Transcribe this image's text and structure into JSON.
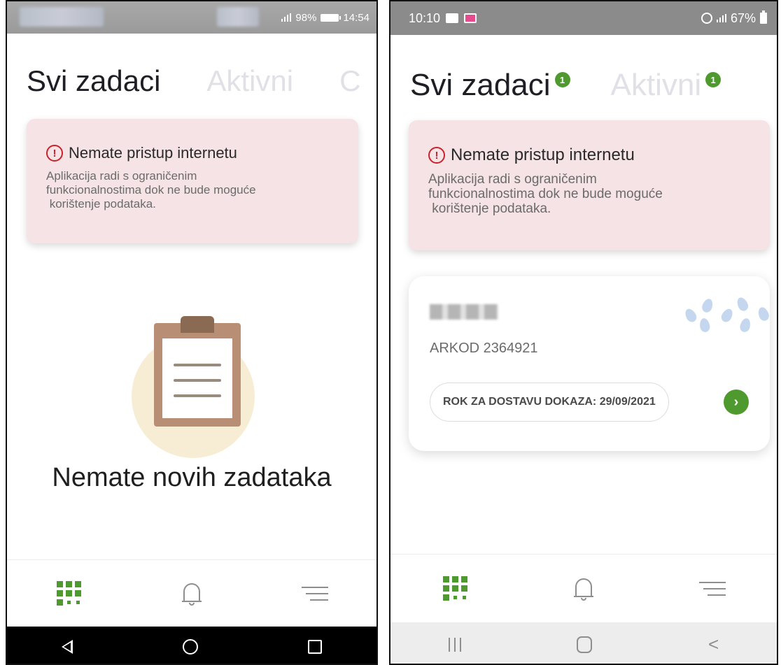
{
  "left_screen": {
    "status_bar": {
      "battery": "98%",
      "time": "14:54"
    },
    "tabs": [
      {
        "label": "Svi zadaci",
        "active": true
      },
      {
        "label": "Aktivni",
        "active": false
      },
      {
        "label": "C",
        "active": false
      }
    ],
    "warning": {
      "title": "Nemate pristup internetu",
      "line1": "Aplikacija radi s ograničenim",
      "line2": "funkcionalnostima dok ne bude moguće",
      "line3": " korištenje podataka."
    },
    "empty_state": {
      "message": "Nemate novih zadataka"
    },
    "bottom_nav": [
      "grid-icon",
      "bell-icon",
      "menu-icon"
    ],
    "system_nav": [
      "back-icon",
      "home-icon",
      "recents-icon"
    ]
  },
  "right_screen": {
    "status_bar": {
      "time": "10:10",
      "battery": "67%"
    },
    "tabs": [
      {
        "label": "Svi zadaci",
        "badge": "1",
        "active": true
      },
      {
        "label": "Aktivni",
        "badge": "1",
        "active": false
      }
    ],
    "warning": {
      "title": "Nemate pristup internetu",
      "line1": "Aplikacija radi s ograničenim",
      "line2": "funkcionalnostima dok ne bude moguće",
      "line3": " korištenje podataka."
    },
    "task_card": {
      "arkod": "ARKOD 2364921",
      "deadline_label": "ROK ZA DOSTAVU DOKAZA: 29/09/2021",
      "go_symbol": "›"
    },
    "bottom_nav": [
      "grid-icon",
      "bell-icon",
      "menu-icon"
    ],
    "system_nav": [
      "recents-icon",
      "home-icon",
      "back-icon"
    ],
    "system_back_symbol": "<"
  },
  "colors": {
    "accent_green": "#4f9a2f",
    "warning_bg": "#f5e3e5",
    "warning_icon": "#c8232c",
    "inactive_tab": "#dfe1e6"
  }
}
